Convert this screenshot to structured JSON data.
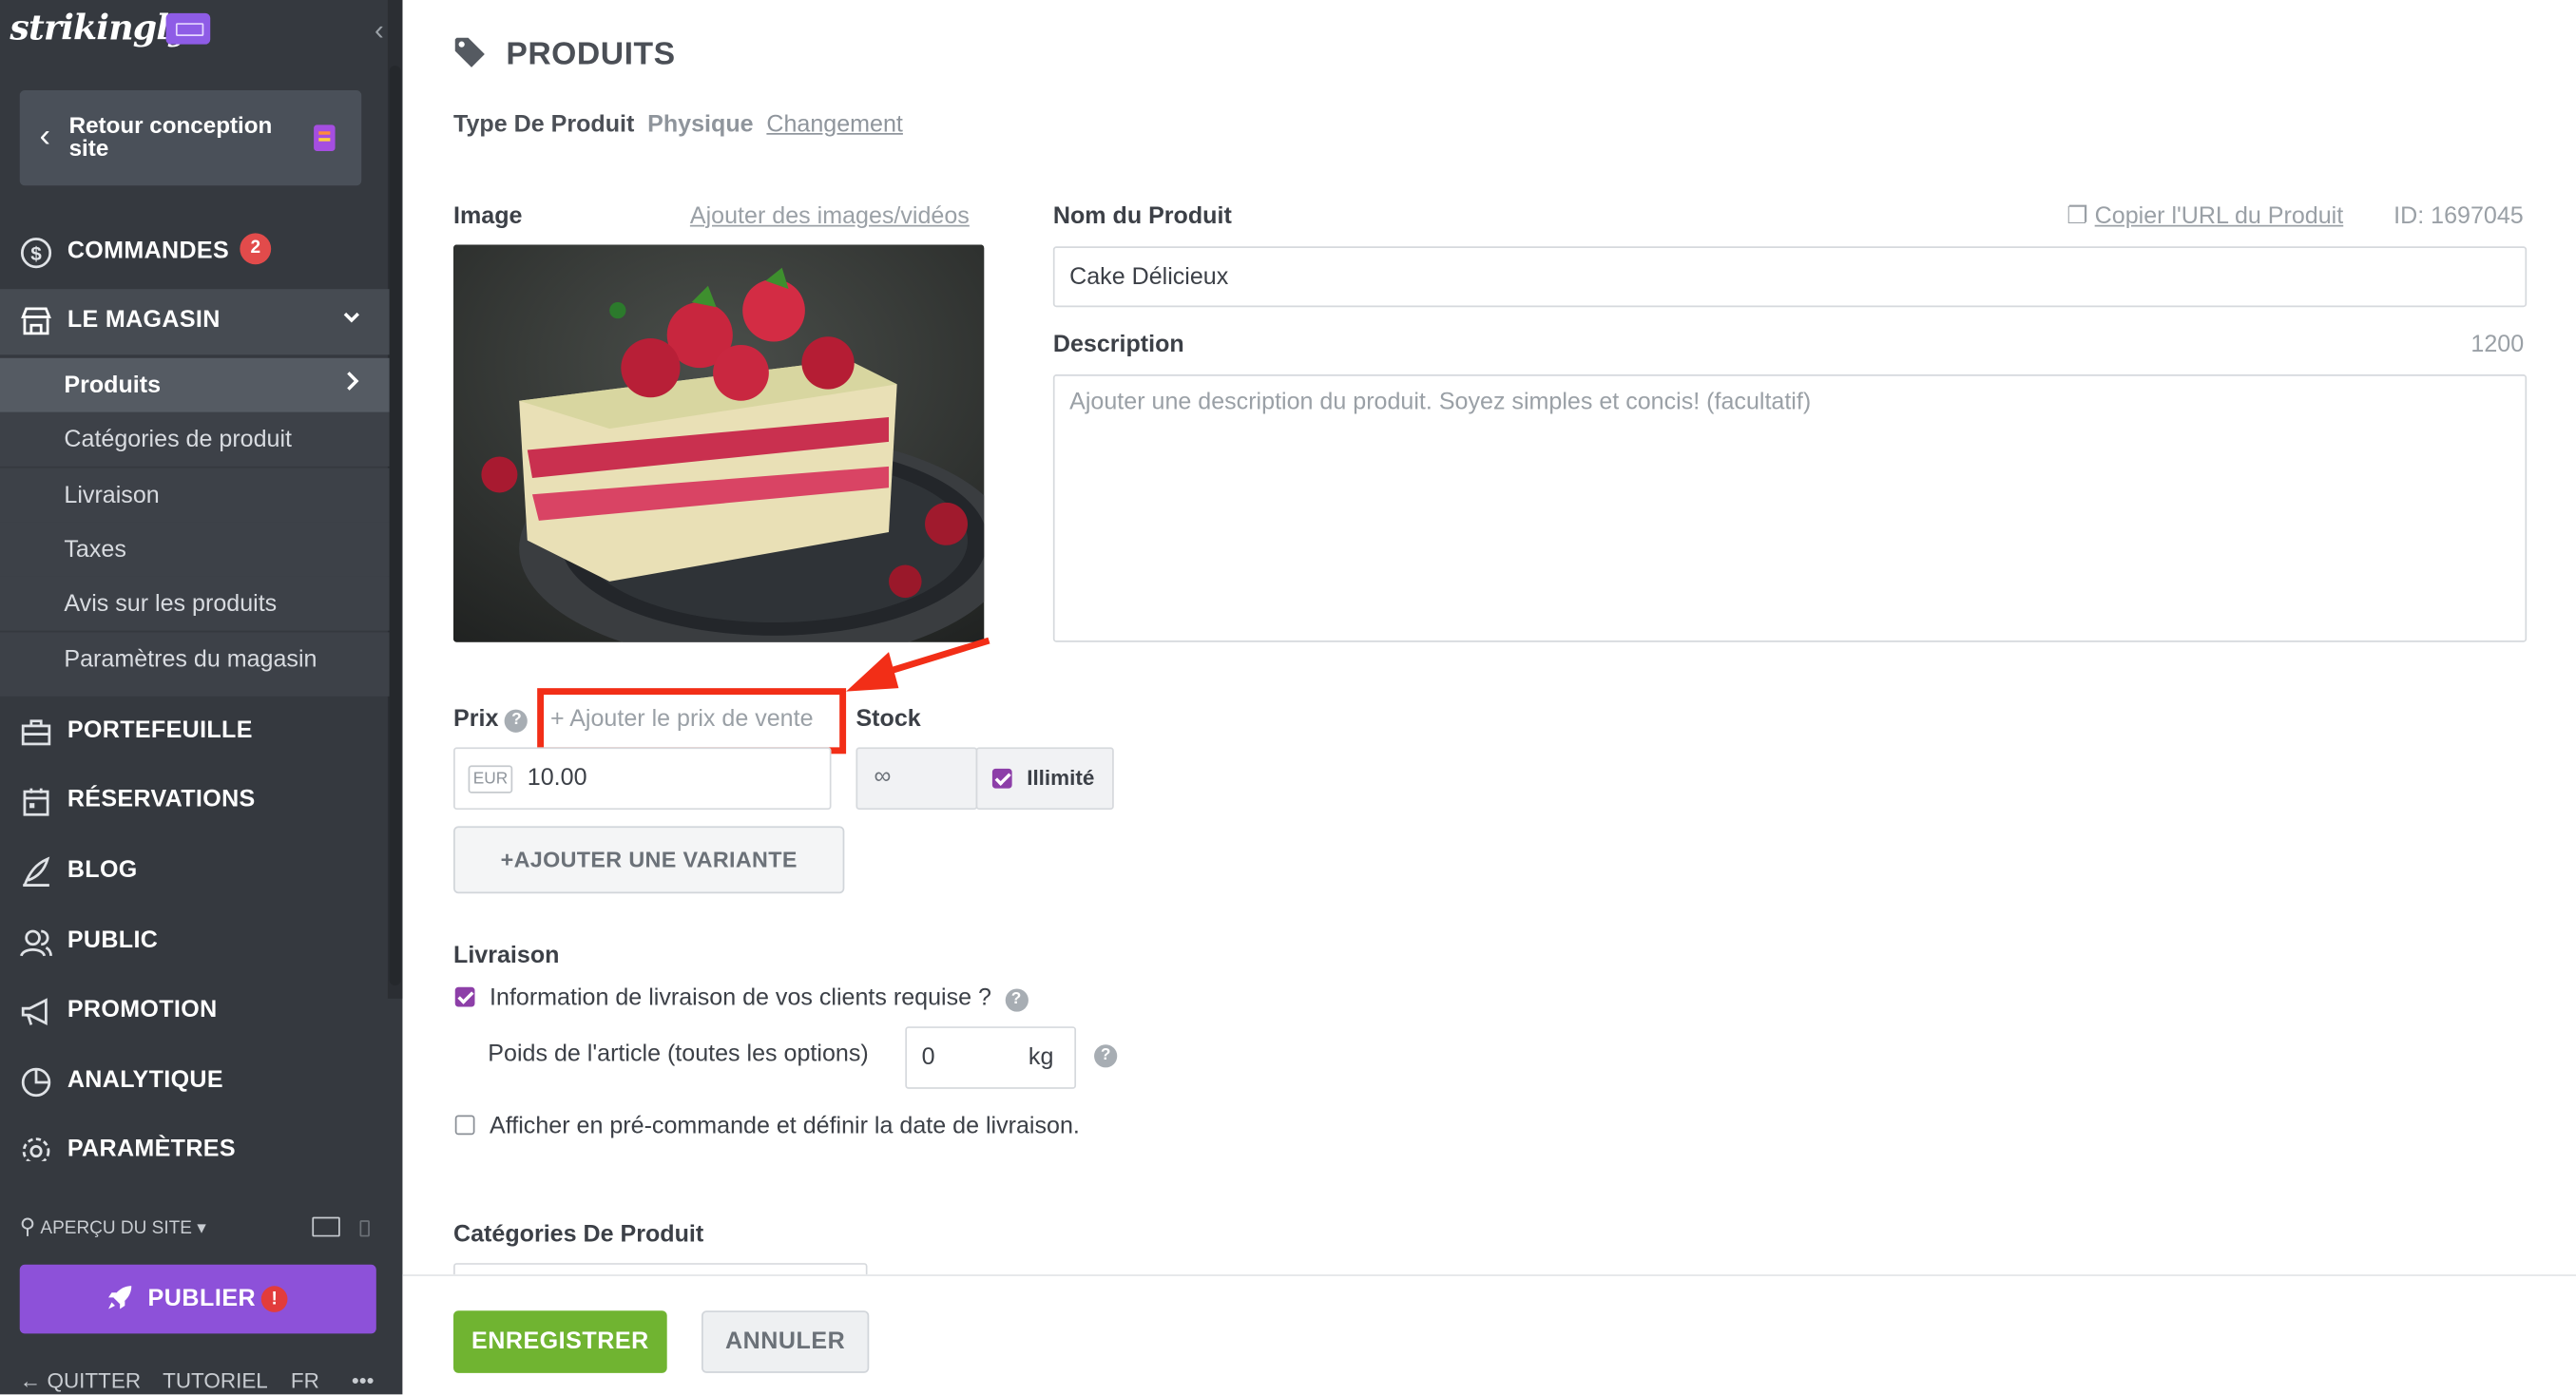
{
  "sidebar": {
    "logo": "strikingly",
    "back_button": "Retour conception site",
    "nav": {
      "orders": "COMMANDES",
      "orders_badge": "2",
      "store": "LE MAGASIN",
      "portfolio": "PORTEFEUILLE",
      "reservations": "RÉSERVATIONS",
      "blog": "BLOG",
      "audience": "PUBLIC",
      "promotion": "PROMOTION",
      "analytics": "ANALYTIQUE",
      "settings": "PARAMÈTRES"
    },
    "store_items": [
      {
        "label": "Produits"
      },
      {
        "label": "Catégories de produit"
      },
      {
        "label": "Livraison"
      },
      {
        "label": "Taxes"
      },
      {
        "label": "Avis sur les produits"
      },
      {
        "label": "Paramètres du magasin"
      }
    ],
    "preview": "APERÇU DU SITE",
    "publish": "PUBLIER",
    "publish_alert": "!",
    "footer": {
      "quit": "QUITTER",
      "tutorial": "TUTORIEL",
      "lang": "FR",
      "more": "•••"
    }
  },
  "main": {
    "title": "PRODUITS",
    "product_type_label": "Type De Produit",
    "product_type_value": "Physique",
    "product_type_change": "Changement",
    "image_label": "Image",
    "add_media": "Ajouter des images/vidéos",
    "name_label": "Nom du Produit",
    "copy_url": "Copier l'URL du Produit",
    "product_id": "ID: 1697045",
    "name_value": "Cake Délicieux",
    "description_label": "Description",
    "description_count": "1200",
    "description_placeholder": "Ajouter une description du produit. Soyez simples et concis! (facultatif)",
    "price_label": "Prix",
    "add_sale_price": "+ Ajouter le prix de vente",
    "stock_label": "Stock",
    "currency": "EUR",
    "price_value": "10.00",
    "stock_value": "∞",
    "unlimited_label": "Illimité",
    "add_variant": "AJOUTER UNE VARIANTE",
    "shipping_label": "Livraison",
    "shipping_info": "Information de livraison de vos clients requise ?",
    "weight_label": "Poids de l'article (toutes les options)",
    "weight_value": "0",
    "weight_unit": "kg",
    "preorder": "Afficher en pré-commande et définir la date de livraison.",
    "categories_label": "Catégories De Produit",
    "save": "ENREGISTRER",
    "cancel": "ANNULER"
  },
  "colors": {
    "accent_purple": "#8d51d9",
    "save_green": "#70b431",
    "highlight_red": "#f22e17",
    "sidebar_bg": "#35393f"
  }
}
